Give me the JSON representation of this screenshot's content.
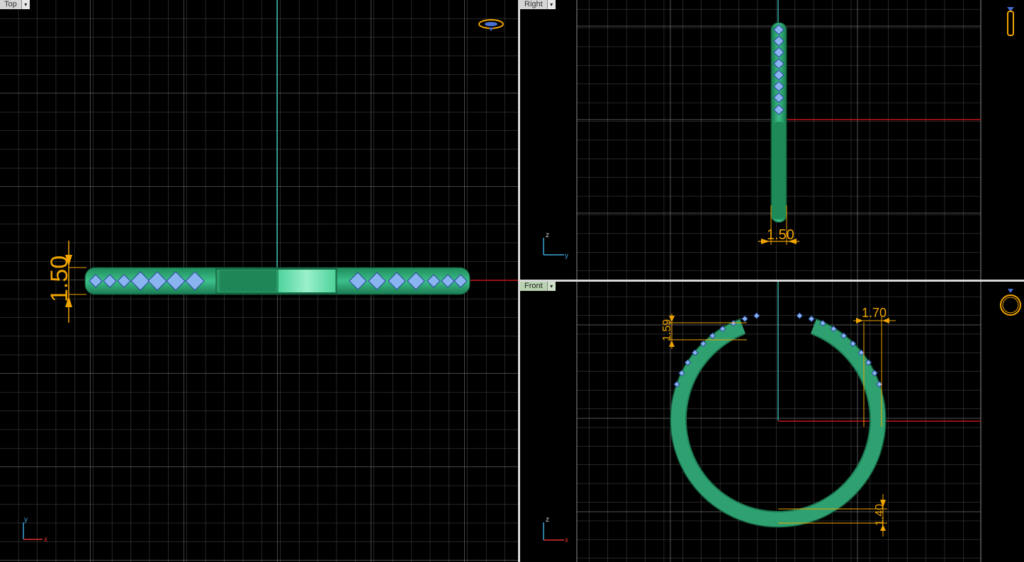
{
  "viewports": {
    "top": {
      "label": "Top",
      "active": false,
      "dimension": "1.50",
      "axis_v": "y",
      "axis_h": "x"
    },
    "right": {
      "label": "Right",
      "active": false,
      "dimension": "1.50",
      "axis_v": "z",
      "axis_h": "y"
    },
    "front": {
      "label": "Front",
      "active": true,
      "dim_gap_height": "1.59",
      "dim_width": "1.70",
      "dim_bottom": "1.40",
      "axis_v": "z",
      "axis_h": "x"
    }
  },
  "dropdown_glyph": "▾",
  "icons": {
    "top": "ring-top-view-icon",
    "right": "ring-side-view-icon",
    "front": "ring-front-view-icon"
  },
  "colors": {
    "grid": "#5a5a5a",
    "grid_major": "#8c8c8c",
    "axis_green": "#2fb3a6",
    "axis_red": "#c41818",
    "ring_green": "#2fa070",
    "ring_light": "#7ee2b8",
    "stone_blue": "#8ab4f0",
    "dimension": "#f0a400"
  }
}
